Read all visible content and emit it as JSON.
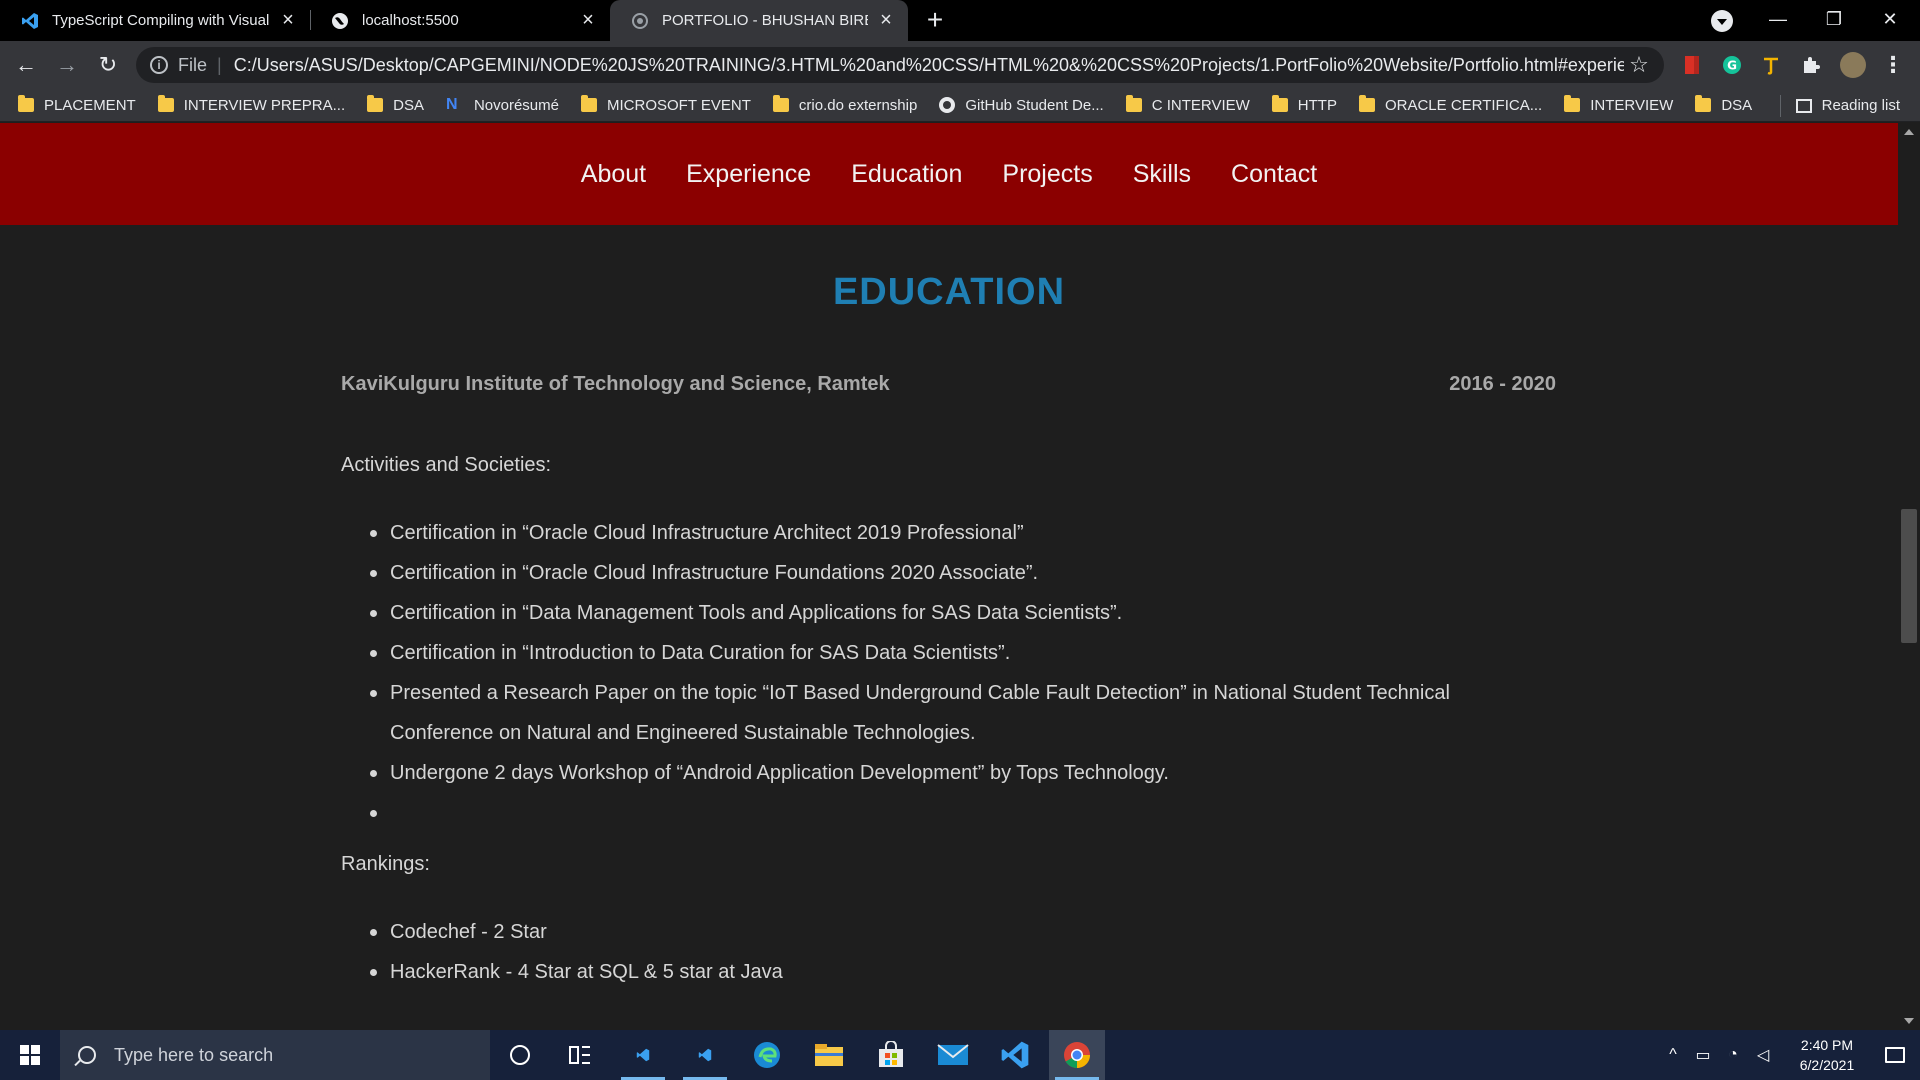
{
  "browser": {
    "tabs": [
      {
        "title": "TypeScript Compiling with Visual",
        "icon": "vscode-icon",
        "close": "×"
      },
      {
        "title": "localhost:5500",
        "icon": "globe-icon",
        "close": "×"
      },
      {
        "title": "PORTFOLIO - BHUSHAN BIRE",
        "icon": "globe-icon",
        "close": "×",
        "active": true
      }
    ],
    "new_tab": "+",
    "window_controls": {
      "minimize": "—",
      "restore": "❐",
      "close": "✕"
    },
    "nav": {
      "back": "←",
      "forward": "→",
      "reload": "↻"
    },
    "address": {
      "scheme_label": "File",
      "separator": "|",
      "url": "C:/Users/ASUS/Desktop/CAPGEMINI/NODE%20JS%20TRAINING/3.HTML%20and%20CSS/HTML%20&%20CSS%20Projects/1.PortFolio%20Website/Portfolio.html#experience",
      "bookmark_star": "☆"
    },
    "extensions": [
      "bookmark-ext-icon",
      "grammarly-icon",
      "translate-ext-icon",
      "puzzle-icon",
      "avatar"
    ],
    "menu_glyph": "⋮",
    "bookmarks": [
      {
        "label": "PLACEMENT",
        "icon": "folder-icon"
      },
      {
        "label": "INTERVIEW PREPRA...",
        "icon": "folder-icon"
      },
      {
        "label": "DSA",
        "icon": "folder-icon"
      },
      {
        "label": "Novorésumé",
        "icon": "novoresume-icon"
      },
      {
        "label": "MICROSOFT EVENT",
        "icon": "folder-icon"
      },
      {
        "label": "crio.do externship",
        "icon": "folder-icon"
      },
      {
        "label": "GitHub Student De...",
        "icon": "github-icon"
      },
      {
        "label": "C INTERVIEW",
        "icon": "folder-icon"
      },
      {
        "label": "HTTP",
        "icon": "folder-icon"
      },
      {
        "label": "ORACLE CERTIFICA...",
        "icon": "folder-icon"
      },
      {
        "label": "INTERVIEW",
        "icon": "folder-icon"
      },
      {
        "label": "DSA",
        "icon": "folder-icon"
      }
    ],
    "reading_list": "Reading list"
  },
  "page": {
    "nav": [
      "About",
      "Experience",
      "Education",
      "Projects",
      "Skills",
      "Contact"
    ],
    "section_title": "EDUCATION",
    "institution": "KaviKulguru Institute of Technology and Science, Ramtek",
    "years": "2016 - 2020",
    "activities_heading": "Activities and Societies:",
    "activities": [
      "Certification in “Oracle Cloud Infrastructure Architect 2019 Professional”",
      "Certification in “Oracle Cloud Infrastructure Foundations 2020 Associate”.",
      "Certification in “Data Management Tools and Applications for SAS Data Scientists”.",
      "Certification in “Introduction to Data Curation for SAS Data Scientists”.",
      "Presented a Research Paper on the topic “IoT Based Underground Cable Fault Detection” in National Student Technical Conference on Natural and Engineered Sustainable Technologies.",
      "Undergone 2 days Workshop of “Android Application Development” by Tops Technology.",
      ""
    ],
    "rankings_heading": "Rankings:",
    "rankings": [
      "Codechef - 2 Star",
      "HackerRank - 4 Star at SQL & 5 star at Java"
    ]
  },
  "taskbar": {
    "search_placeholder": "Type here to search",
    "time": "2:40 PM",
    "date": "6/2/2021",
    "colors": {
      "accent": "#76b9ed",
      "nav_red": "#8b0000",
      "title_blue": "#1f7fb3"
    }
  }
}
